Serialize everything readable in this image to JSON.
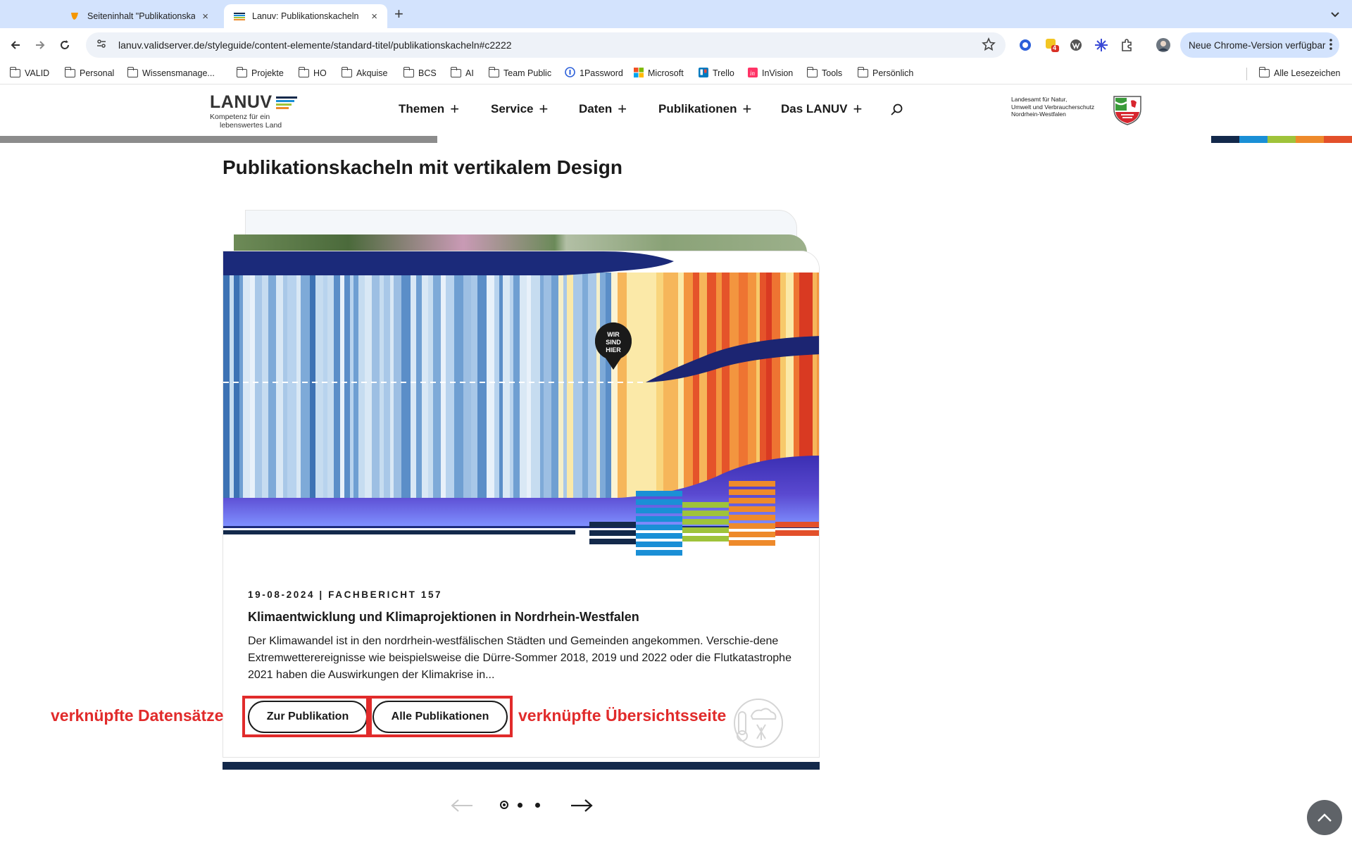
{
  "browser": {
    "tabs": [
      {
        "title": "Seiteninhalt \"Publikationskacheln\"",
        "close": "×"
      },
      {
        "title": "Lanuv: Publikationskacheln",
        "close": "×"
      }
    ],
    "new_tab": "+",
    "url": "lanuv.validserver.de/styleguide/content-elemente/standard-titel/publikationskacheln#c2222",
    "update_button": "Neue Chrome-Version verfügbar",
    "extension_badge": "4",
    "bookmarks": [
      "VALID",
      "Personal",
      "Wissensmanage...",
      "Projekte",
      "HO",
      "Akquise",
      "BCS",
      "AI",
      "Team Public",
      "1Password",
      "Microsoft",
      "Trello",
      "InVision",
      "Tools",
      "Persönlich"
    ],
    "all_bookmarks": "Alle Lesezeichen"
  },
  "site": {
    "logo": {
      "word": "LANUV",
      "tagline_1": "Kompetenz für ein",
      "tagline_2": "lebenswertes Land"
    },
    "nav": [
      "Themen",
      "Service",
      "Daten",
      "Publikationen",
      "Das LANUV"
    ],
    "agency_lines": [
      "Landesamt für Natur,",
      "Umwelt und Verbraucherschutz",
      "Nordrhein-Westfalen"
    ],
    "scroll_progress": 0.42,
    "brand_colors": [
      "#13294b",
      "#1a8fd6",
      "#9fc33a",
      "#ee8a2b",
      "#e3502a"
    ]
  },
  "content": {
    "page_title": "Publikationskacheln mit vertikalem Design",
    "card": {
      "image_marker": [
        "WIR",
        "SIND",
        "HIER"
      ],
      "meta": "19-08-2024 | FACHBERICHT 157",
      "title": "Klimaentwicklung und Klimaprojektionen in Nordrhein-Westfalen",
      "text": "Der Klimawandel ist in den nordrhein-westfälischen Städten und Gemeinden angekommen. Verschie-dene Extremwetterereignisse wie beispielsweise die Dürre-Sommer 2018, 2019 und 2022 oder die Flutkatastrophe 2021 haben die Auswirkungen der Klimakrise in...",
      "button_primary": "Zur Publikation",
      "button_secondary": "Alle Publikationen"
    },
    "annotations": {
      "left": "verknüpfte Datensätze",
      "right": "verknüpfte Übersichtsseite",
      "color": "#e12b2b"
    },
    "carousel": {
      "active_slide": 1,
      "slide_count": 3
    }
  }
}
